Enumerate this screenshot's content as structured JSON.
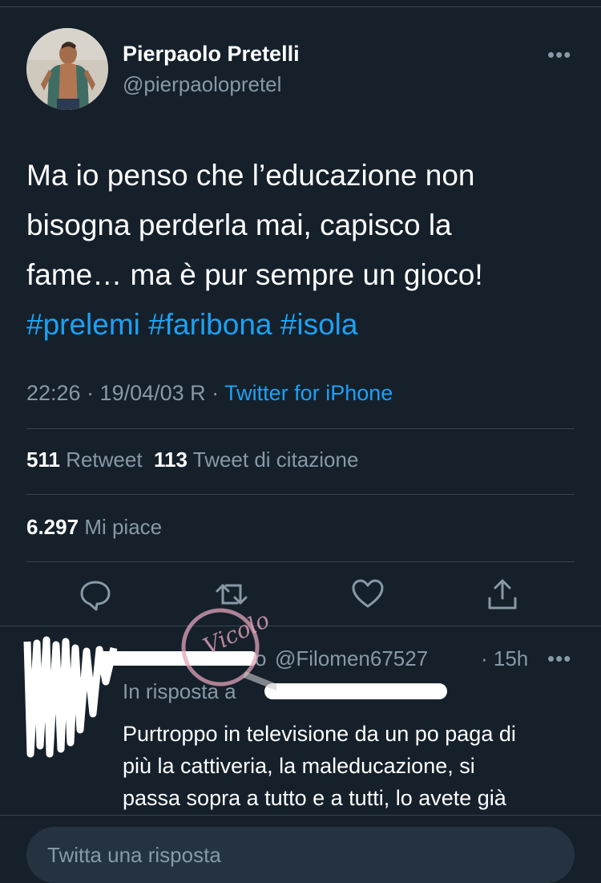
{
  "tweet": {
    "author_name": "Pierpaolo Pretelli",
    "author_handle": "@pierpaolopretel",
    "more_label": "•••",
    "text_lines": [
      "Ma io penso che l’educazione non",
      "bisogna perderla mai, capisco la",
      "fame… ma è pur sempre un gioco!"
    ],
    "hashtags": [
      "#prelemi",
      "#faribona",
      "#isola"
    ],
    "timestamp": "22:26 · 19/04/03 R ·",
    "source": "Twitter for iPhone",
    "retweets_count": "511",
    "retweets_label": "Retweet",
    "quotes_count": "113",
    "quotes_label": "Tweet di citazione",
    "likes_count": "6.297",
    "likes_label": "Mi piace"
  },
  "actions": [
    "reply-icon",
    "retweet-icon",
    "like-icon",
    "share-icon"
  ],
  "reply": {
    "name_end": "o",
    "handle": "@Filomen67527",
    "time": "· 15h",
    "more_label": "•••",
    "reply_to": "In risposta a",
    "text_lines": [
      "Purtroppo in televisione da un po paga di",
      "più la cattiveria, la maleducazione, si",
      "passa sopra a tutto e a tutti, lo avete già"
    ]
  },
  "composer": {
    "placeholder": "Twitta una risposta"
  },
  "watermark": {
    "text": "Vicolo"
  },
  "colors": {
    "background": "#15202b",
    "accent": "#1da1f2",
    "secondary": "#8899a6",
    "divider": "#38444d"
  }
}
